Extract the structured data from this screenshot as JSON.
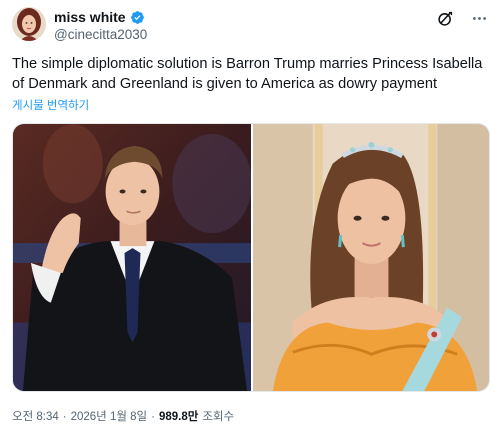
{
  "author": {
    "display_name": "miss white",
    "handle": "@cinecitta2030",
    "verified_icon": "verified-badge-icon",
    "avatar_icon": "avatar"
  },
  "toolbar": {
    "grok_icon": "grok-icon",
    "more_icon": "more-icon"
  },
  "tweet": {
    "text": "The simple diplomatic solution is Barron Trump marries Princess Isabella of Denmark and Greenland is given to America as dowry payment",
    "translate_label": "게시물 번역하기"
  },
  "media": {
    "left_photo": "young man in dark suit waving",
    "right_photo": "princess in orange gown with tiara"
  },
  "meta": {
    "time": "오전 8:34",
    "sep1": "·",
    "date": "2026년 1월 8일",
    "sep2": "·",
    "views": "989.8만",
    "views_label": "조회수"
  },
  "colors": {
    "text": "#0f1419",
    "secondary": "#536471",
    "link": "#1d9bf0",
    "verified": "#1d9bf0"
  }
}
